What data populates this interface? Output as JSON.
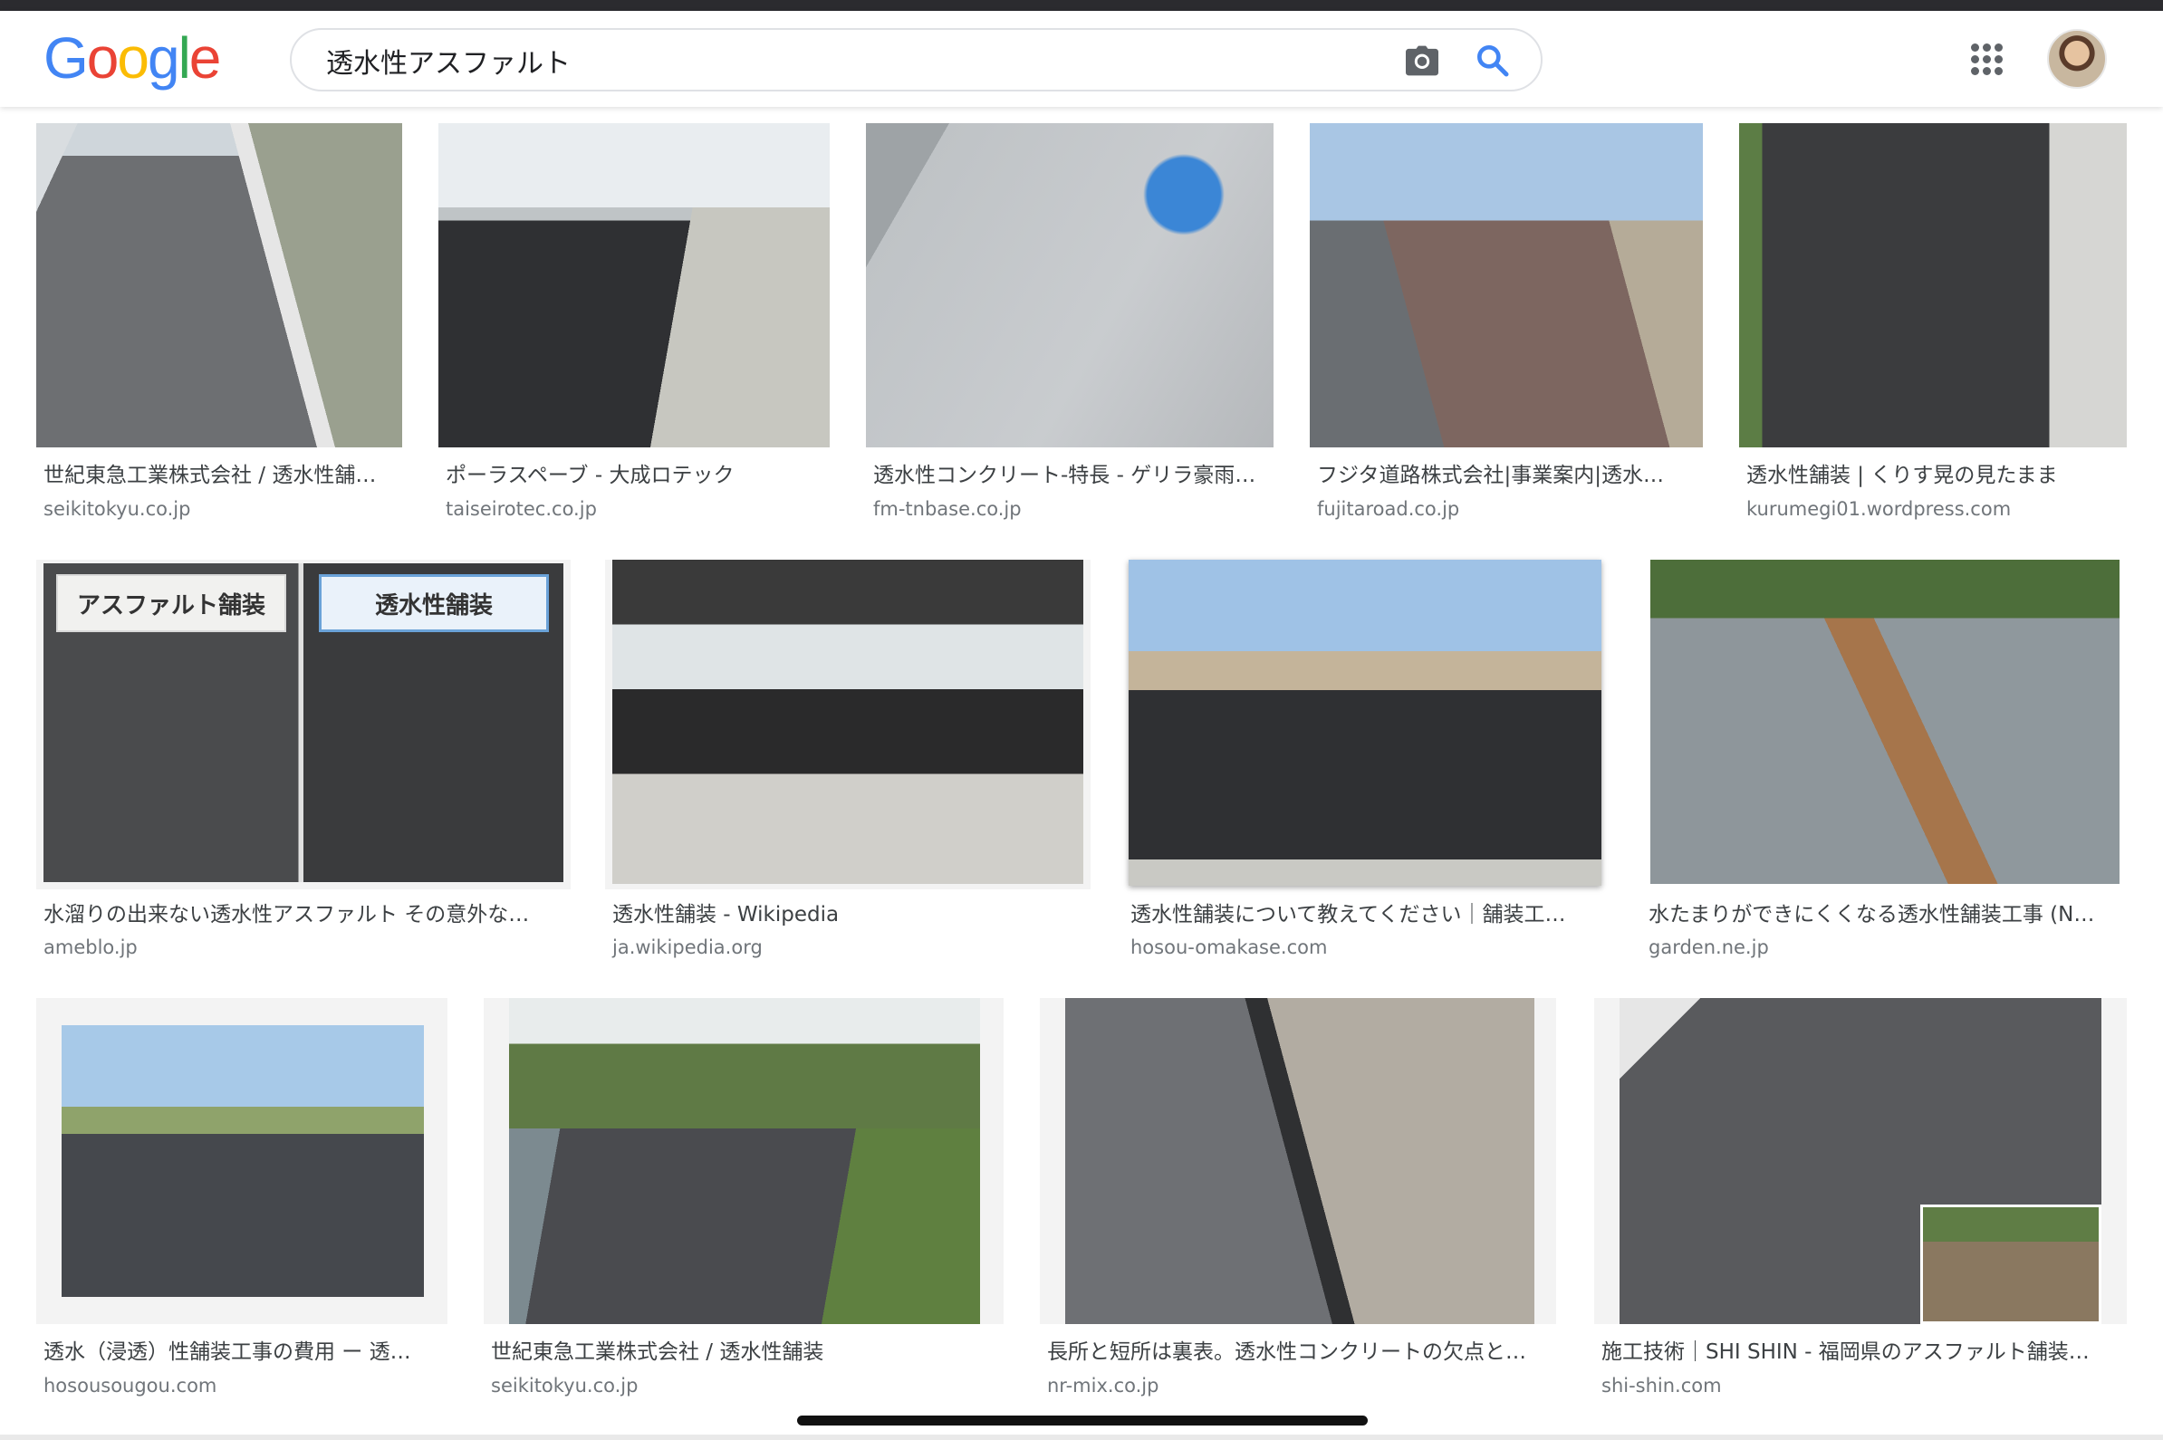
{
  "header": {
    "logo_letters": [
      "G",
      "o",
      "o",
      "g",
      "l",
      "e"
    ],
    "search_value": "透水性アスファルト",
    "icons": {
      "camera": "camera-icon",
      "search": "search-icon",
      "apps": "apps-grid-icon"
    },
    "logo_colors": [
      "#4285F4",
      "#EA4335",
      "#FBBC05",
      "#4285F4",
      "#34A853",
      "#EA4335"
    ]
  },
  "results": [
    {
      "caption": "世紀東急工業株式会社 / 透水性舗…",
      "source": "seikitokyu.co.jp"
    },
    {
      "caption": "ポーラスペーブ - 大成ロテック",
      "source": "taiseirotec.co.jp"
    },
    {
      "caption": "透水性コンクリート-特長 - ゲリラ豪雨…",
      "source": "fm-tnbase.co.jp"
    },
    {
      "caption": "フジタ道路株式会社|事業案内|透水…",
      "source": "fujitaroad.co.jp"
    },
    {
      "caption": "透水性舗装 | くりす晃の見たまま",
      "source": "kurumegi01.wordpress.com"
    },
    {
      "caption": "水溜りの出来ない透水性アスファルト その意外な…",
      "source": "ameblo.jp",
      "overlay_left": "アスファルト舗装",
      "overlay_right": "透水性舗装"
    },
    {
      "caption": "透水性舗装 - Wikipedia",
      "source": "ja.wikipedia.org"
    },
    {
      "caption": "透水性舗装について教えてください｜舗装工…",
      "source": "hosou-omakase.com"
    },
    {
      "caption": "水たまりができにくくなる透水性舗装工事 (N…",
      "source": "garden.ne.jp"
    },
    {
      "caption": "透水（浸透）性舗装工事の費用 ー 透…",
      "source": "hosousougou.com"
    },
    {
      "caption": "世紀東急工業株式会社 / 透水性舗装",
      "source": "seikitokyu.co.jp"
    },
    {
      "caption": "長所と短所は裏表。透水性コンクリートの欠点と…",
      "source": "nr-mix.co.jp"
    },
    {
      "caption": "施工技術｜SHI SHIN - 福岡県のアスファルト舗装…",
      "source": "shi-shin.com"
    }
  ]
}
